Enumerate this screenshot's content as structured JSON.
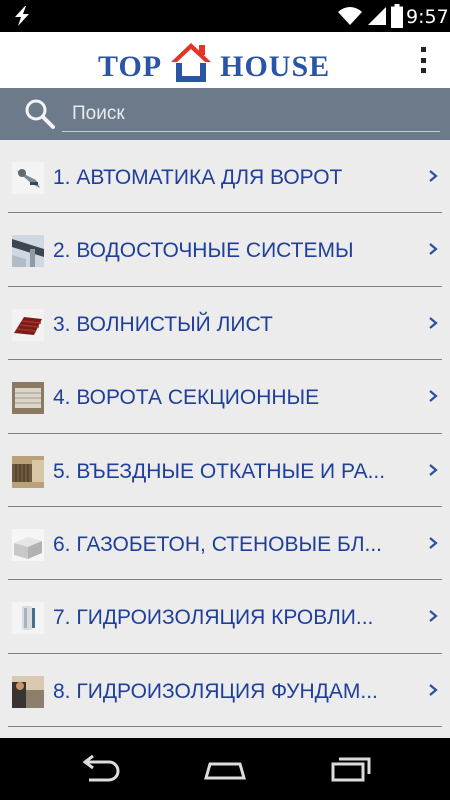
{
  "status_bar": {
    "time": "9:57",
    "icons": [
      "flash-icon",
      "wifi-icon",
      "signal-icon",
      "battery-icon"
    ]
  },
  "header": {
    "logo_left": "TOP",
    "logo_right": "HOUSE",
    "brand_color": "#2a55a7",
    "roof_color": "#e2342b",
    "menu_icon": "overflow-menu-icon"
  },
  "search": {
    "placeholder": "Поиск",
    "value": "",
    "icon": "search-icon",
    "bar_color": "#6d7a89"
  },
  "categories": [
    {
      "label": "1. АВТОМАТИКА ДЛЯ ВОРОТ",
      "icon": "gate-automation-thumb"
    },
    {
      "label": "2. ВОДОСТОЧНЫЕ СИСТЕМЫ",
      "icon": "gutter-system-thumb"
    },
    {
      "label": "3. ВОЛНИСТЫЙ ЛИСТ",
      "icon": "corrugated-sheet-thumb"
    },
    {
      "label": "4. ВОРОТА СЕКЦИОННЫЕ",
      "icon": "sectional-gate-thumb"
    },
    {
      "label": "5. ВЪЕЗДНЫЕ ОТКАТНЫЕ И РА...",
      "icon": "sliding-gate-thumb"
    },
    {
      "label": "6. ГАЗОБЕТОН, СТЕНОВЫЕ БЛ...",
      "icon": "aerated-block-thumb"
    },
    {
      "label": "7. ГИДРОИЗОЛЯЦИЯ КРОВЛИ...",
      "icon": "roof-waterproofing-thumb"
    },
    {
      "label": "8. ГИДРОИЗОЛЯЦИЯ ФУНДАМ...",
      "icon": "foundation-waterproofing-thumb"
    }
  ],
  "nav_bar": {
    "buttons": [
      "back-icon",
      "home-icon",
      "recents-icon"
    ]
  }
}
